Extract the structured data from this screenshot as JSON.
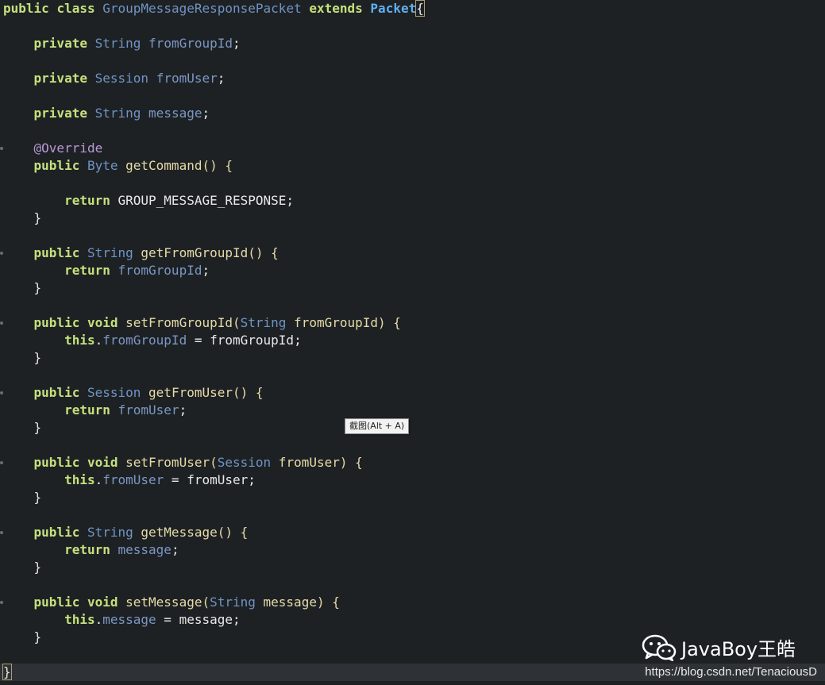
{
  "code": {
    "class_decl": {
      "kw_public": "public",
      "kw_class": "class",
      "class_name": "GroupMessageResponsePacket",
      "kw_extends": "extends",
      "parent": "Packet",
      "open_brace": "{"
    },
    "fields": [
      {
        "modifier": "private",
        "type": "String",
        "name": "fromGroupId",
        "end": ";"
      },
      {
        "modifier": "private",
        "type": "Session",
        "name": "fromUser",
        "end": ";"
      },
      {
        "modifier": "private",
        "type": "String",
        "name": "message",
        "end": ";"
      }
    ],
    "annotation": "@Override",
    "getCommand": {
      "kw": "public",
      "type": "Byte",
      "sig": " getCommand() {",
      "ret_kw": "return",
      "ret_val": " GROUP_MESSAGE_RESPONSE;",
      "close": "}"
    },
    "getFromGroupId": {
      "kw": "public",
      "type": "String",
      "sig": " getFromGroupId() {",
      "ret_kw": "return",
      "ret_field": "fromGroupId",
      "ret_end": ";",
      "close": "}"
    },
    "setFromGroupId": {
      "kw": "public",
      "void": "void",
      "sig1": " setFromGroupId(",
      "ptype": "String",
      "sig2": " fromGroupId) {",
      "this": "this",
      "dot": ".",
      "field": "fromGroupId",
      "assign": " = fromGroupId;",
      "close": "}"
    },
    "getFromUser": {
      "kw": "public",
      "type": "Session",
      "sig": " getFromUser() {",
      "ret_kw": "return",
      "ret_field": "fromUser",
      "ret_end": ";",
      "close": "}"
    },
    "setFromUser": {
      "kw": "public",
      "void": "void",
      "sig1": " setFromUser(",
      "ptype": "Session",
      "sig2": " fromUser) {",
      "this": "this",
      "dot": ".",
      "field": "fromUser",
      "assign": " = fromUser;",
      "close": "}"
    },
    "getMessage": {
      "kw": "public",
      "type": "String",
      "sig": " getMessage() {",
      "ret_kw": "return",
      "ret_field": "message",
      "ret_end": ";",
      "close": "}"
    },
    "setMessage": {
      "kw": "public",
      "void": "void",
      "sig1": " setMessage(",
      "ptype": "String",
      "sig2": " message) {",
      "this": "this",
      "dot": ".",
      "field": "message",
      "assign": " = message;",
      "close": "}"
    },
    "class_close": "}"
  },
  "tooltip": "截图(Alt + A)",
  "watermark": {
    "brand": "JavaBoy王皓",
    "icon": "wechat-icon",
    "url": "https://blog.csdn.net/TenaciousD"
  }
}
